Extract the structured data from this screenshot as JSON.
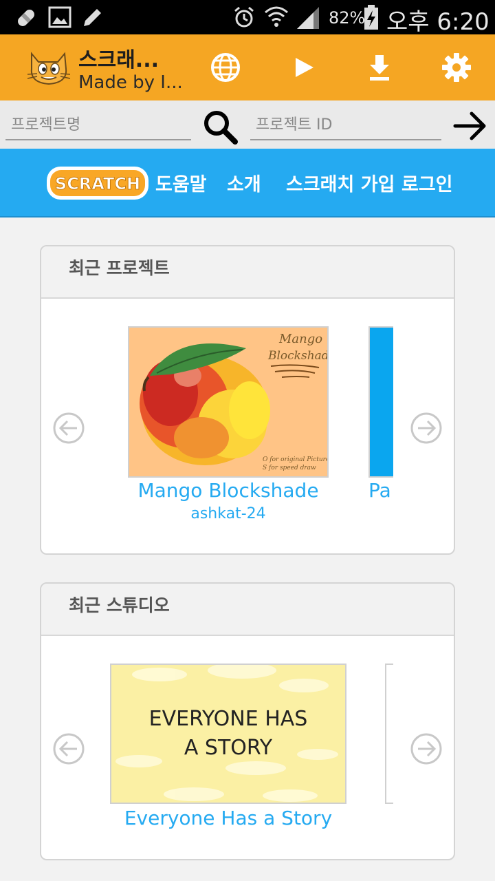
{
  "status_bar": {
    "battery_percent": "82%",
    "time": "오후 6:20",
    "icons": [
      "bandage-icon",
      "image-icon",
      "pencil-icon",
      "alarm-icon",
      "wifi-icon",
      "signal-icon",
      "battery-charging-icon"
    ]
  },
  "app_bar": {
    "title": "스크래...",
    "subtitle": "Made by I...",
    "icons": [
      "scratch-cat-icon",
      "globe-icon",
      "play-icon",
      "download-icon",
      "gear-icon"
    ],
    "accent_color": "#f5a623"
  },
  "search": {
    "project_name_placeholder": "프로젝트명",
    "project_id_placeholder": "프로젝트 ID"
  },
  "scratch_nav": {
    "logo_text": "SCRATCH",
    "links": [
      "도움말",
      "소개",
      "스크래치 가입",
      "로그인"
    ],
    "background_color": "#25aaf1"
  },
  "recent_projects": {
    "heading": "최근 프로젝트",
    "items": [
      {
        "title": "Mango Blockshade",
        "author": "ashkat-24",
        "thumbnail_text": [
          "Mango",
          "Blockshade"
        ],
        "thumbnail_note": [
          "O for original Picture",
          "S for speed draw"
        ]
      },
      {
        "title": "Pa",
        "author": ""
      }
    ]
  },
  "recent_studios": {
    "heading": "최근 스튜디오",
    "items": [
      {
        "title": "Everyone Has a Story",
        "thumbnail_text": [
          "EVERYONE HAS",
          "A STORY"
        ]
      }
    ]
  }
}
